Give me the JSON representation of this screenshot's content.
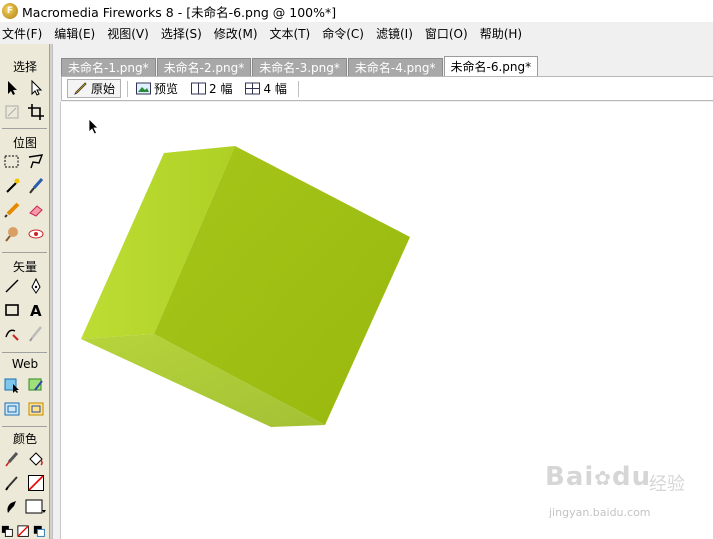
{
  "window": {
    "title": "Macromedia Fireworks 8 - [未命名-6.png @ 100%*]",
    "app_icon": "fireworks-logo-icon"
  },
  "menubar": {
    "items": [
      "文件(F)",
      "编辑(E)",
      "视图(V)",
      "选择(S)",
      "修改(M)",
      "文本(T)",
      "命令(C)",
      "滤镜(I)",
      "窗口(O)",
      "帮助(H)"
    ]
  },
  "tools": {
    "sections": {
      "select": "选择",
      "bitmap": "位图",
      "vector": "矢量",
      "web": "Web",
      "colors": "颜色"
    },
    "select_icons": [
      "pointer-icon",
      "subselect-icon",
      "scale-icon",
      "crop-icon"
    ],
    "bitmap_icons": [
      "marquee-icon",
      "lasso-icon",
      "magic-wand-icon",
      "brush-icon",
      "pencil-icon",
      "eraser-icon",
      "blur-icon",
      "eye-dropper-icon"
    ],
    "vector_icons": [
      "line-icon",
      "pen-icon",
      "rectangle-icon",
      "text-icon",
      "freeform-icon",
      "knife-icon"
    ],
    "web_icons": [
      "hotspot-icon",
      "slice-icon",
      "hide-slices-icon",
      "show-slices-icon"
    ],
    "color_icons": [
      "eyedropper-color-icon",
      "paint-bucket-icon",
      "stroke-color-icon",
      "fill-color-icon",
      "default-colors-icon",
      "no-color-icon",
      "swap-colors-icon"
    ]
  },
  "document": {
    "tabs": [
      "未命名-1.png*",
      "未命名-2.png*",
      "未命名-3.png*",
      "未命名-4.png*",
      "未命名-6.png*"
    ],
    "active_tab": 4,
    "view_buttons": {
      "original": "原始",
      "preview": "预览",
      "two_up": "2 幅",
      "four_up": "4 幅"
    }
  },
  "canvas": {
    "object": "green-cube",
    "colors": {
      "front": "#9ebd12",
      "left": "#b4d81e",
      "bottom": "#a9c73a"
    }
  },
  "watermark": {
    "logo": "Bai",
    "logo_suffix": "du",
    "jingyan": "经验",
    "url": "jingyan.baidu.com"
  }
}
